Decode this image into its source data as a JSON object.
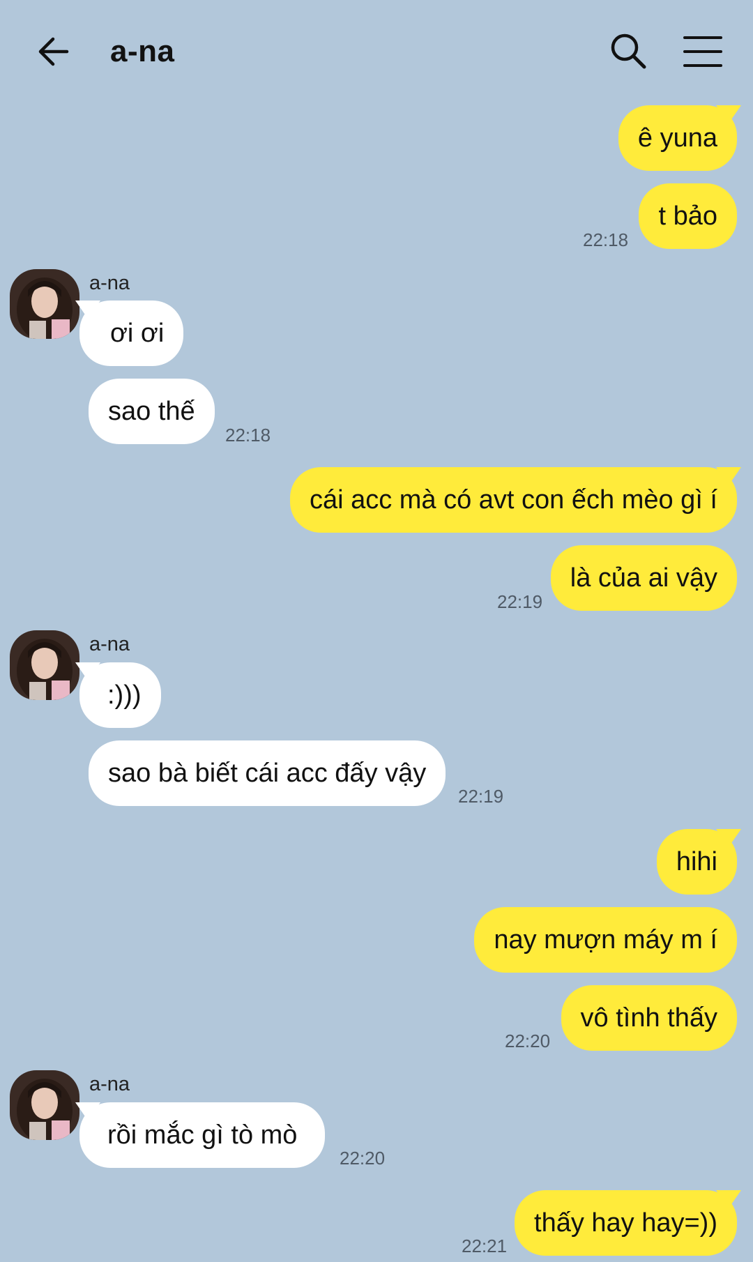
{
  "header": {
    "title": "a-na",
    "back_icon": "arrow-left-icon",
    "search_icon": "search-icon",
    "menu_icon": "hamburger-menu-icon"
  },
  "colors": {
    "background": "#b2c7da",
    "my_bubble": "#ffeb3b",
    "their_bubble": "#ffffff"
  },
  "messages": [
    {
      "from": "me",
      "text": "ê yuna"
    },
    {
      "from": "me",
      "text": "t bảo",
      "time": "22:18"
    },
    {
      "from": "them",
      "sender": "a-na",
      "text": "ơi ơi"
    },
    {
      "from": "them",
      "text": "sao thế",
      "time": "22:18"
    },
    {
      "from": "me",
      "text": "cái acc mà có avt con ếch mèo gì í"
    },
    {
      "from": "me",
      "text": "là của ai vậy",
      "time": "22:19"
    },
    {
      "from": "them",
      "sender": "a-na",
      "text": ":)))"
    },
    {
      "from": "them",
      "text": "sao bà biết cái acc đấy vậy",
      "time": "22:19"
    },
    {
      "from": "me",
      "text": "hihi"
    },
    {
      "from": "me",
      "text": "nay mượn máy m í"
    },
    {
      "from": "me",
      "text": "vô tình thấy",
      "time": "22:20"
    },
    {
      "from": "them",
      "sender": "a-na",
      "text": "rồi mắc gì tò mò",
      "time": "22:20"
    },
    {
      "from": "me",
      "text": "thấy hay hay=))",
      "time": "22:21"
    }
  ]
}
